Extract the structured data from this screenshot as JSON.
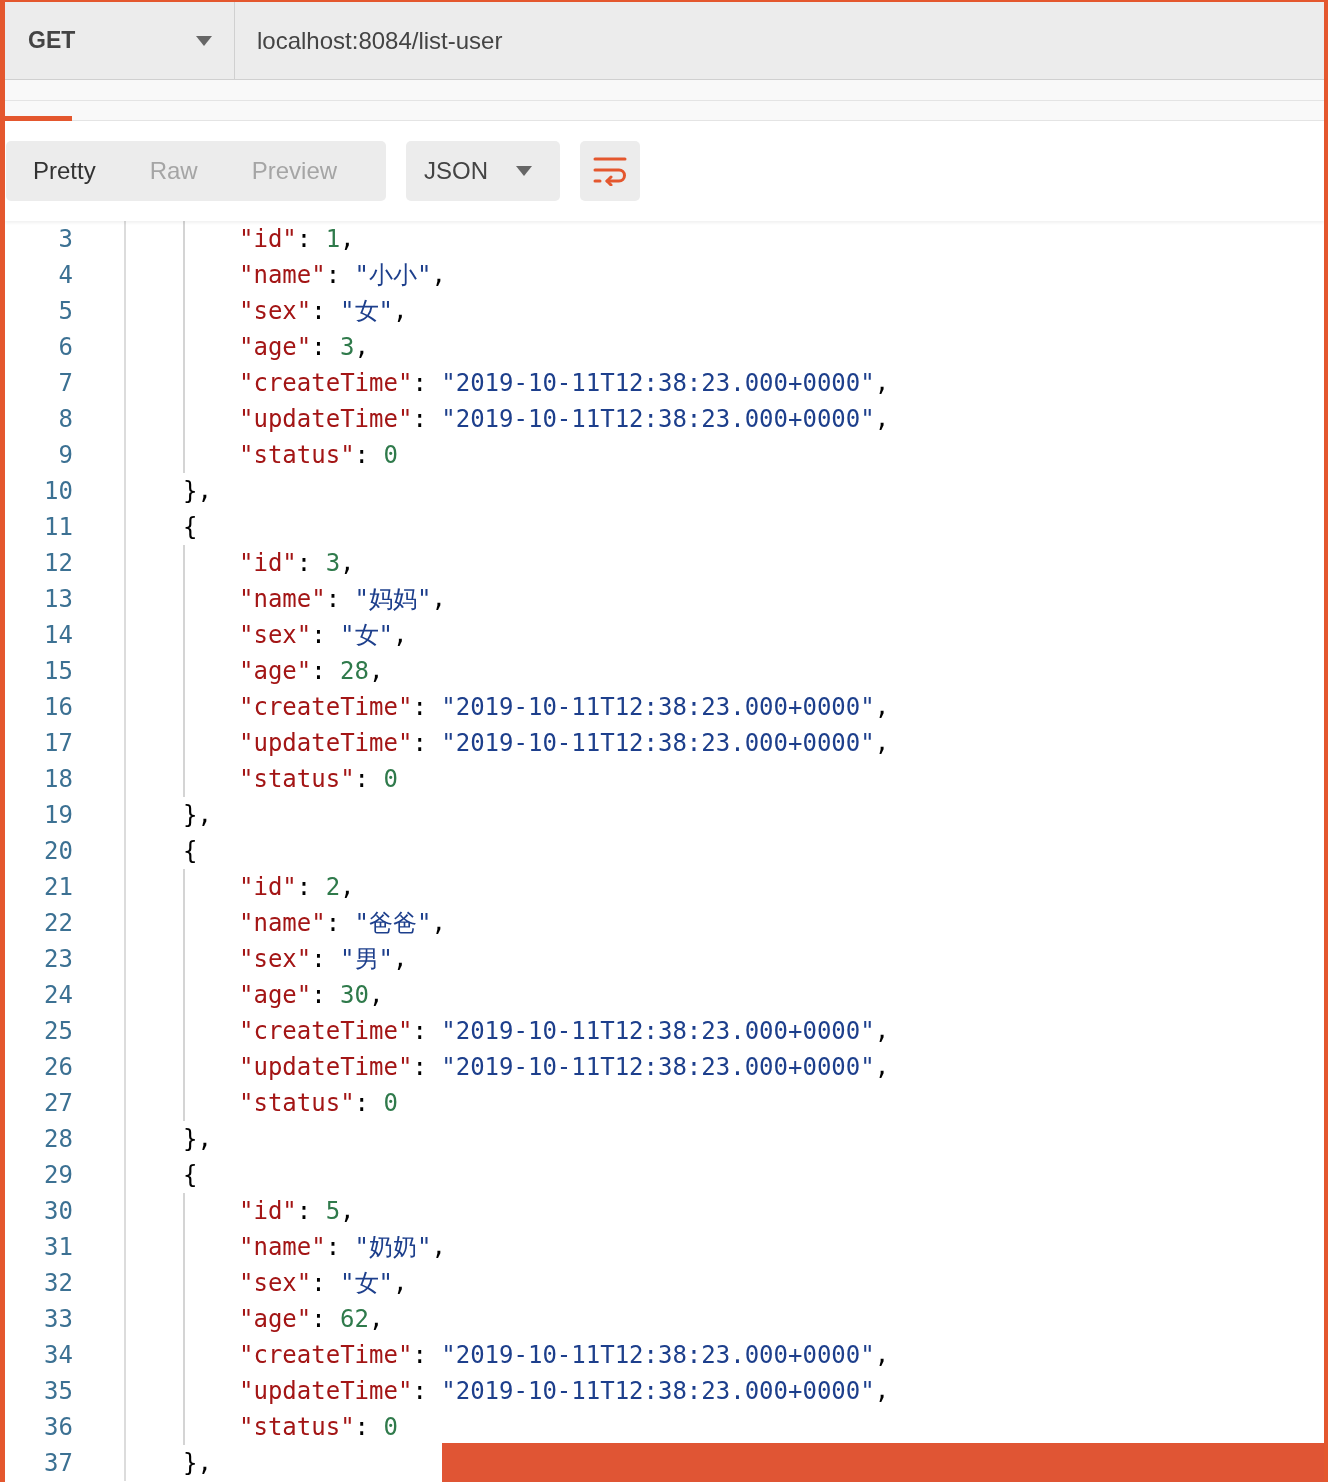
{
  "request": {
    "method": "GET",
    "url": "localhost:8084/list-user"
  },
  "view_tabs": [
    {
      "label": "Pretty",
      "selected": true
    },
    {
      "label": "Raw",
      "selected": false
    },
    {
      "label": "Preview",
      "selected": false
    }
  ],
  "format": {
    "label": "JSON"
  },
  "code_lines": [
    {
      "number": "3",
      "kind": "number",
      "key": "\"id\"",
      "colon": ":",
      "value": "1",
      "comma": ","
    },
    {
      "number": "4",
      "kind": "string",
      "key": "\"name\"",
      "colon": ":",
      "value": "\"小小\"",
      "comma": ","
    },
    {
      "number": "5",
      "kind": "string",
      "key": "\"sex\"",
      "colon": ":",
      "value": "\"女\"",
      "comma": ","
    },
    {
      "number": "6",
      "kind": "number",
      "key": "\"age\"",
      "colon": ":",
      "value": "3",
      "comma": ","
    },
    {
      "number": "7",
      "kind": "string",
      "key": "\"createTime\"",
      "colon": ":",
      "value": "\"2019-10-11T12:38:23.000+0000\"",
      "comma": ","
    },
    {
      "number": "8",
      "kind": "string",
      "key": "\"updateTime\"",
      "colon": ":",
      "value": "\"2019-10-11T12:38:23.000+0000\"",
      "comma": ","
    },
    {
      "number": "9",
      "kind": "number",
      "key": "\"status\"",
      "colon": ":",
      "value": "0"
    },
    {
      "number": "10",
      "kind": "brace",
      "text": "},"
    },
    {
      "number": "11",
      "kind": "brace",
      "text": "{"
    },
    {
      "number": "12",
      "kind": "number",
      "key": "\"id\"",
      "colon": ":",
      "value": "3",
      "comma": ","
    },
    {
      "number": "13",
      "kind": "string",
      "key": "\"name\"",
      "colon": ":",
      "value": "\"妈妈\"",
      "comma": ","
    },
    {
      "number": "14",
      "kind": "string",
      "key": "\"sex\"",
      "colon": ":",
      "value": "\"女\"",
      "comma": ","
    },
    {
      "number": "15",
      "kind": "number",
      "key": "\"age\"",
      "colon": ":",
      "value": "28",
      "comma": ","
    },
    {
      "number": "16",
      "kind": "string",
      "key": "\"createTime\"",
      "colon": ":",
      "value": "\"2019-10-11T12:38:23.000+0000\"",
      "comma": ","
    },
    {
      "number": "17",
      "kind": "string",
      "key": "\"updateTime\"",
      "colon": ":",
      "value": "\"2019-10-11T12:38:23.000+0000\"",
      "comma": ","
    },
    {
      "number": "18",
      "kind": "number",
      "key": "\"status\"",
      "colon": ":",
      "value": "0"
    },
    {
      "number": "19",
      "kind": "brace",
      "text": "},"
    },
    {
      "number": "20",
      "kind": "brace",
      "text": "{"
    },
    {
      "number": "21",
      "kind": "number",
      "key": "\"id\"",
      "colon": ":",
      "value": "2",
      "comma": ","
    },
    {
      "number": "22",
      "kind": "string",
      "key": "\"name\"",
      "colon": ":",
      "value": "\"爸爸\"",
      "comma": ","
    },
    {
      "number": "23",
      "kind": "string",
      "key": "\"sex\"",
      "colon": ":",
      "value": "\"男\"",
      "comma": ","
    },
    {
      "number": "24",
      "kind": "number",
      "key": "\"age\"",
      "colon": ":",
      "value": "30",
      "comma": ","
    },
    {
      "number": "25",
      "kind": "string",
      "key": "\"createTime\"",
      "colon": ":",
      "value": "\"2019-10-11T12:38:23.000+0000\"",
      "comma": ","
    },
    {
      "number": "26",
      "kind": "string",
      "key": "\"updateTime\"",
      "colon": ":",
      "value": "\"2019-10-11T12:38:23.000+0000\"",
      "comma": ","
    },
    {
      "number": "27",
      "kind": "number",
      "key": "\"status\"",
      "colon": ":",
      "value": "0"
    },
    {
      "number": "28",
      "kind": "brace",
      "text": "},"
    },
    {
      "number": "29",
      "kind": "brace",
      "text": "{"
    },
    {
      "number": "30",
      "kind": "number",
      "key": "\"id\"",
      "colon": ":",
      "value": "5",
      "comma": ","
    },
    {
      "number": "31",
      "kind": "string",
      "key": "\"name\"",
      "colon": ":",
      "value": "\"奶奶\"",
      "comma": ","
    },
    {
      "number": "32",
      "kind": "string",
      "key": "\"sex\"",
      "colon": ":",
      "value": "\"女\"",
      "comma": ","
    },
    {
      "number": "33",
      "kind": "number",
      "key": "\"age\"",
      "colon": ":",
      "value": "62",
      "comma": ","
    },
    {
      "number": "34",
      "kind": "string",
      "key": "\"createTime\"",
      "colon": ":",
      "value": "\"2019-10-11T12:38:23.000+0000\"",
      "comma": ","
    },
    {
      "number": "35",
      "kind": "string",
      "key": "\"updateTime\"",
      "colon": ":",
      "value": "\"2019-10-11T12:38:23.000+0000\"",
      "comma": ","
    },
    {
      "number": "36",
      "kind": "number",
      "key": "\"status\"",
      "colon": ":",
      "value": "0"
    },
    {
      "number": "37",
      "kind": "brace",
      "text": "},"
    }
  ]
}
